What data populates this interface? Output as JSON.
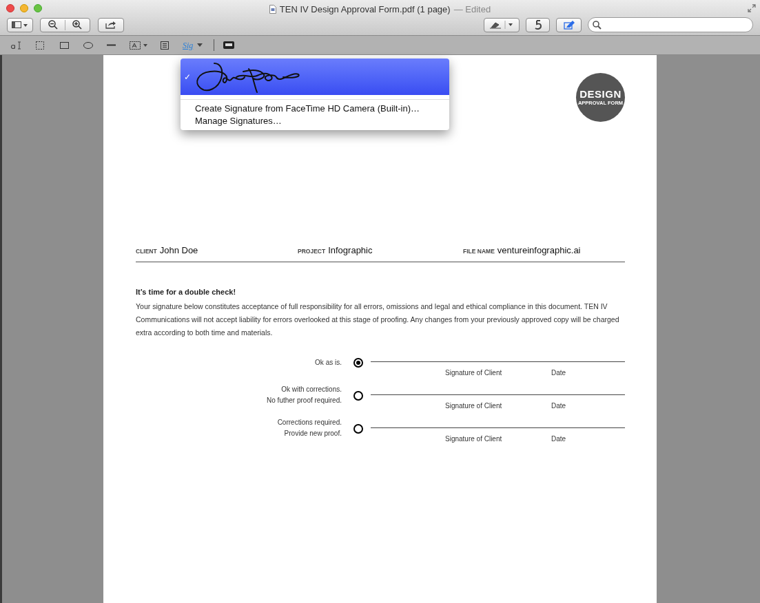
{
  "window": {
    "title": "TEN IV Design Approval Form.pdf (1 page)",
    "status": "— Edited"
  },
  "markup_toolbar": {
    "signature_label": "Sig"
  },
  "signature_menu": {
    "items": [
      {
        "kind": "signature",
        "check": "✓",
        "selected": true
      },
      {
        "kind": "text",
        "label": "Create Signature from FaceTime HD Camera (Built-in)…",
        "selected": false
      },
      {
        "kind": "text",
        "label": "Manage Signatures…",
        "selected": false
      }
    ]
  },
  "badge": {
    "title": "DESIGN",
    "subtitle": "APPROVAL FORM"
  },
  "fields": [
    {
      "label": "CLIENT",
      "value": "John Doe"
    },
    {
      "label": "PROJECT",
      "value": "Infographic"
    },
    {
      "label": "FILE NAME",
      "value": "ventureinfographic.ai"
    }
  ],
  "notice": {
    "heading": "It’s time for a double check!",
    "body": "Your signature below constitutes acceptance of full responsibility for all errors, omissions and legal and ethical compliance in this document. TEN IV Communications will not accept liability for errors overlooked at this stage of proofing. Any changes from your previously approved copy will be charged extra according to both time and materials."
  },
  "options": [
    {
      "label_lines": [
        "Ok as is."
      ],
      "selected": true,
      "signature_caption": "Signature of Client",
      "date_caption": "Date"
    },
    {
      "label_lines": [
        "Ok with corrections.",
        "No futher proof required."
      ],
      "selected": false,
      "signature_caption": "Signature of Client",
      "date_caption": "Date"
    },
    {
      "label_lines": [
        "Corrections required.",
        "Provide new proof."
      ],
      "selected": false,
      "signature_caption": "Signature of Client",
      "date_caption": "Date"
    }
  ]
}
